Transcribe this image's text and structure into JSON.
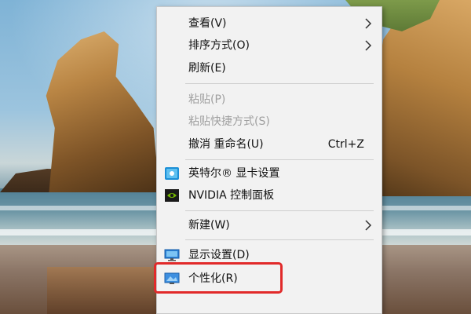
{
  "context_menu": {
    "items": [
      {
        "label": "查看(V)",
        "has_submenu": true,
        "enabled": true
      },
      {
        "label": "排序方式(O)",
        "has_submenu": true,
        "enabled": true
      },
      {
        "label": "刷新(E)",
        "has_submenu": false,
        "enabled": true
      },
      {
        "label": "粘贴(P)",
        "has_submenu": false,
        "enabled": false
      },
      {
        "label": "粘贴快捷方式(S)",
        "has_submenu": false,
        "enabled": false
      },
      {
        "label": "撤消 重命名(U)",
        "shortcut": "Ctrl+Z",
        "has_submenu": false,
        "enabled": true
      },
      {
        "label": "英特尔® 显卡设置",
        "icon": "intel-graphics-icon",
        "has_submenu": false,
        "enabled": true
      },
      {
        "label": "NVIDIA 控制面板",
        "icon": "nvidia-icon",
        "has_submenu": false,
        "enabled": true
      },
      {
        "label": "新建(W)",
        "has_submenu": true,
        "enabled": true
      },
      {
        "label": "显示设置(D)",
        "icon": "display-settings-icon",
        "has_submenu": false,
        "enabled": true
      },
      {
        "label": "个性化(R)",
        "icon": "personalize-icon",
        "has_submenu": false,
        "enabled": true,
        "highlighted": true
      }
    ]
  },
  "colors": {
    "menu_background": "#f2f2f2",
    "highlight_border": "#e12a2a",
    "disabled_text": "#a0a0a0"
  }
}
